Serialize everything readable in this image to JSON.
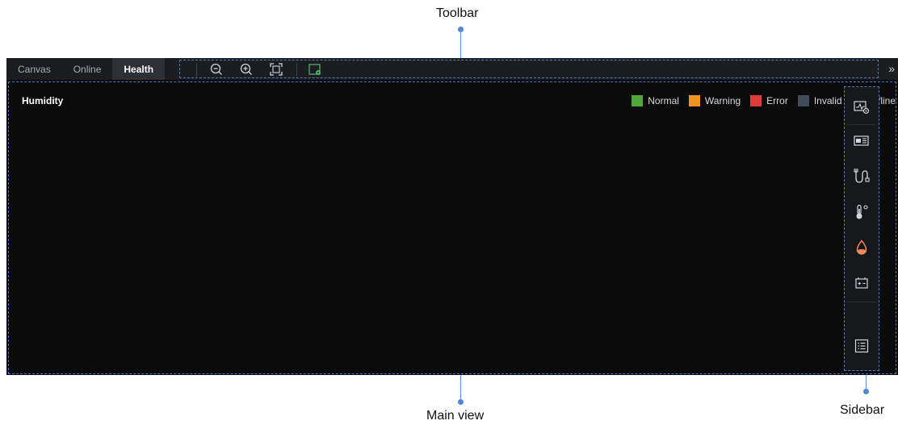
{
  "callouts": {
    "toolbar": "Toolbar",
    "main_view": "Main view",
    "sidebar": "Sidebar"
  },
  "tabs": [
    {
      "label": "Canvas",
      "active": false
    },
    {
      "label": "Online",
      "active": false
    },
    {
      "label": "Health",
      "active": true
    }
  ],
  "toolbar": {
    "icons": [
      "zoom-out-icon",
      "zoom-in-icon",
      "fit-to-screen-icon",
      "map-locate-icon"
    ],
    "more_label": "»"
  },
  "main": {
    "title": "Humidity"
  },
  "legend": [
    {
      "label": "Normal",
      "color": "#4fa73a"
    },
    {
      "label": "Warning",
      "color": "#f0921f"
    },
    {
      "label": "Error",
      "color": "#e03a3a"
    },
    {
      "label": "Invalid",
      "color": "#3f4c5a"
    },
    {
      "label": "Offline",
      "color": "#6b6e74"
    }
  ],
  "sidebar": {
    "icons": [
      "monitor-settings-icon",
      "device-panel-icon",
      "cable-icon",
      "temperature-icon",
      "humidity-drop-icon",
      "battery-icon",
      "list-icon"
    ],
    "active_icon": "humidity-drop-icon",
    "accent": "#f08a5d"
  }
}
